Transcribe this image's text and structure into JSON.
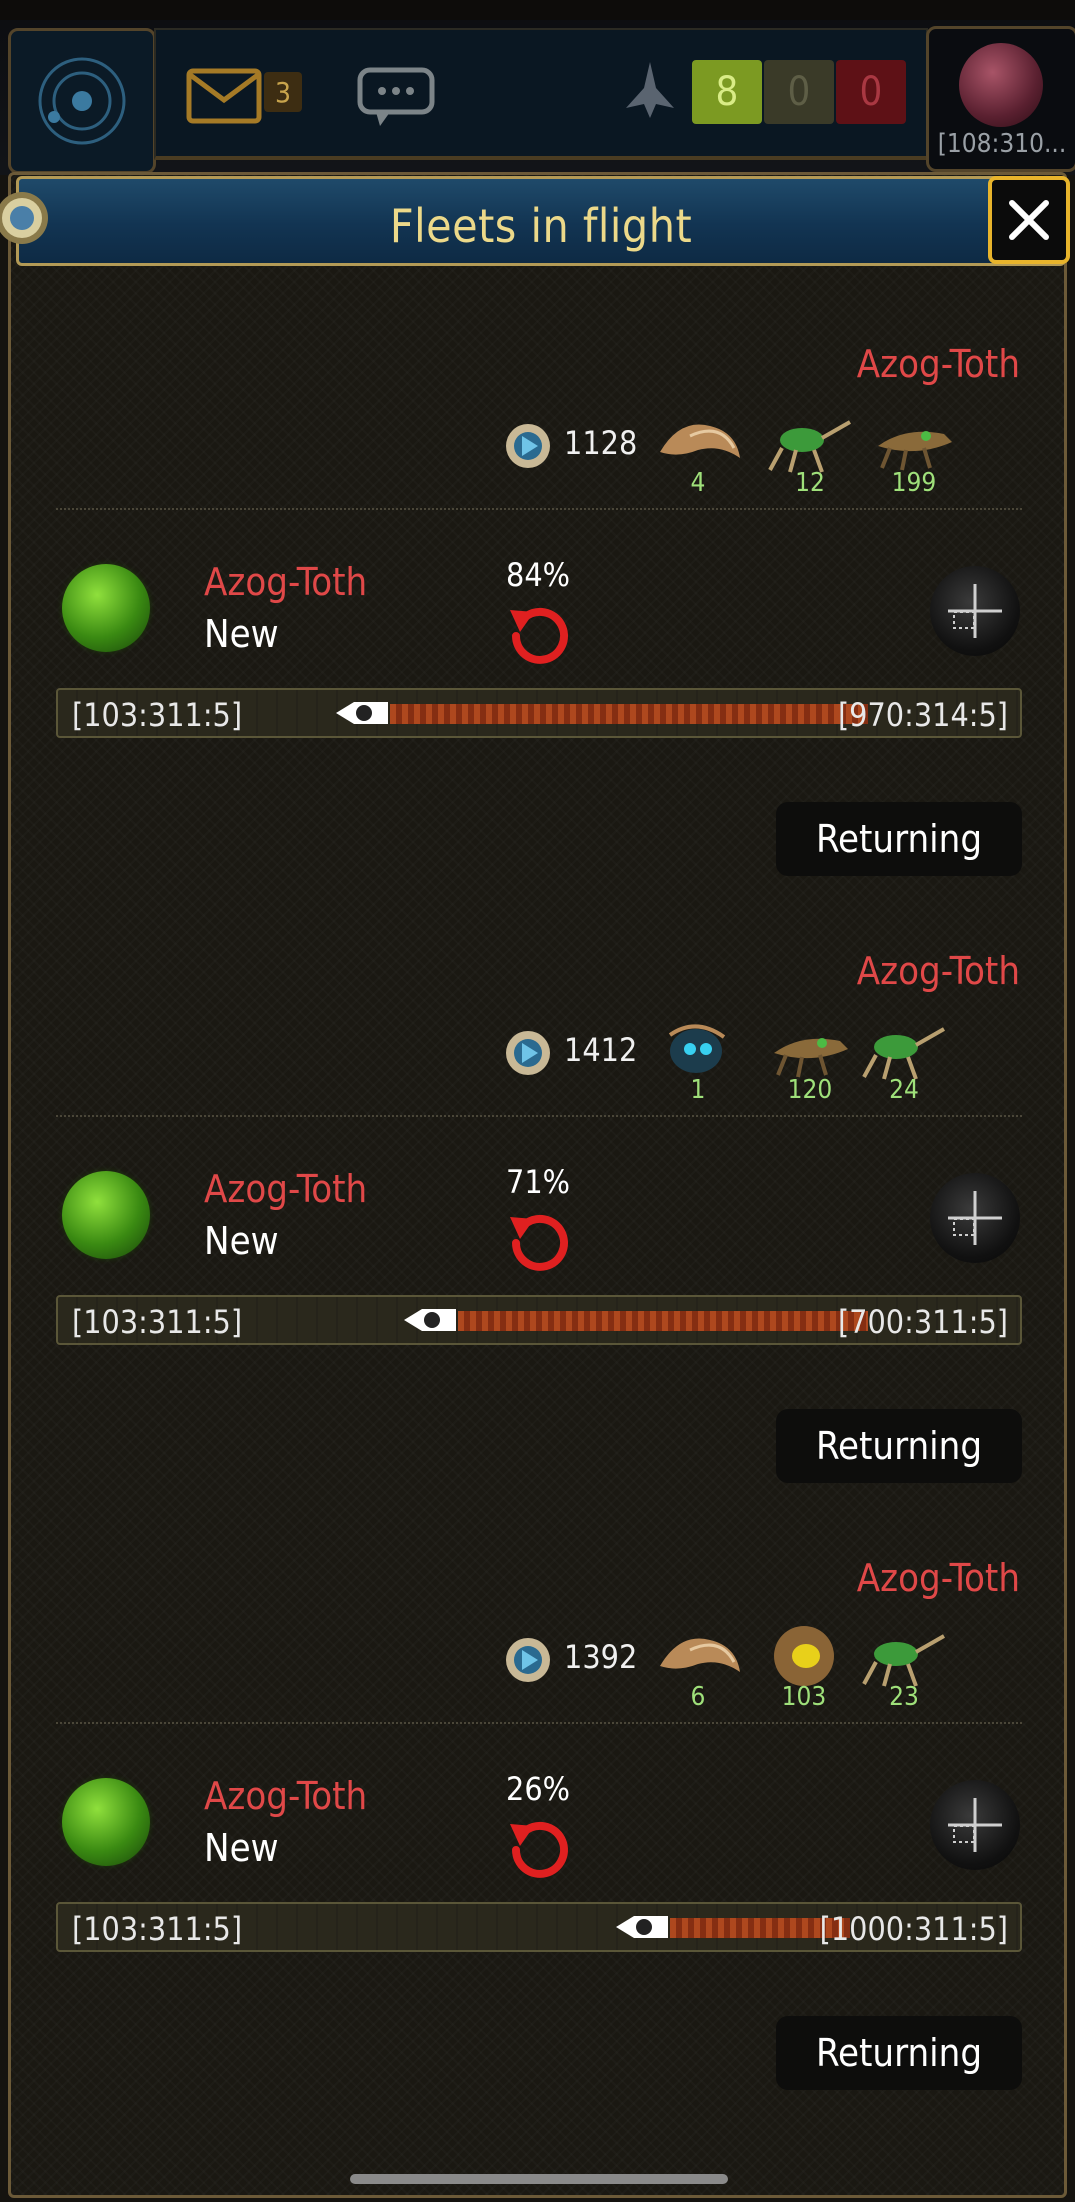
{
  "header": {
    "mail_count": "3",
    "fleet_counts": [
      "8",
      "0",
      "0"
    ],
    "planet_coord": "[108:310..."
  },
  "panel": {
    "title": "Fleets in flight"
  },
  "fleets": [
    {
      "owner": "Azog-Toth",
      "resource": "1128",
      "ships": [
        {
          "icon": "raptor-ship-icon",
          "count": "4"
        },
        {
          "icon": "green-walker-ship-icon",
          "count": "12"
        },
        {
          "icon": "crawler-ship-icon",
          "count": "199"
        }
      ],
      "origin_owner": "Azog-Toth",
      "status": "New",
      "progress": "84%",
      "from": "[103:311:5]",
      "to": "[970:314:5]",
      "mission": "Returning"
    },
    {
      "owner": "Azog-Toth",
      "resource": "1412",
      "ships": [
        {
          "icon": "scarab-ship-icon",
          "count": "1"
        },
        {
          "icon": "crawler-ship-icon",
          "count": "120"
        },
        {
          "icon": "green-walker-ship-icon",
          "count": "24"
        }
      ],
      "origin_owner": "Azog-Toth",
      "status": "New",
      "progress": "71%",
      "from": "[103:311:5]",
      "to": "[700:311:5]",
      "mission": "Returning"
    },
    {
      "owner": "Azog-Toth",
      "resource": "1392",
      "ships": [
        {
          "icon": "raptor-ship-icon",
          "count": "6"
        },
        {
          "icon": "hive-pod-ship-icon",
          "count": "103"
        },
        {
          "icon": "green-walker-ship-icon",
          "count": "23"
        }
      ],
      "origin_owner": "Azog-Toth",
      "status": "New",
      "progress": "26%",
      "from": "[103:311:5]",
      "to": "[1000:311:5]",
      "mission": "Returning"
    }
  ]
}
